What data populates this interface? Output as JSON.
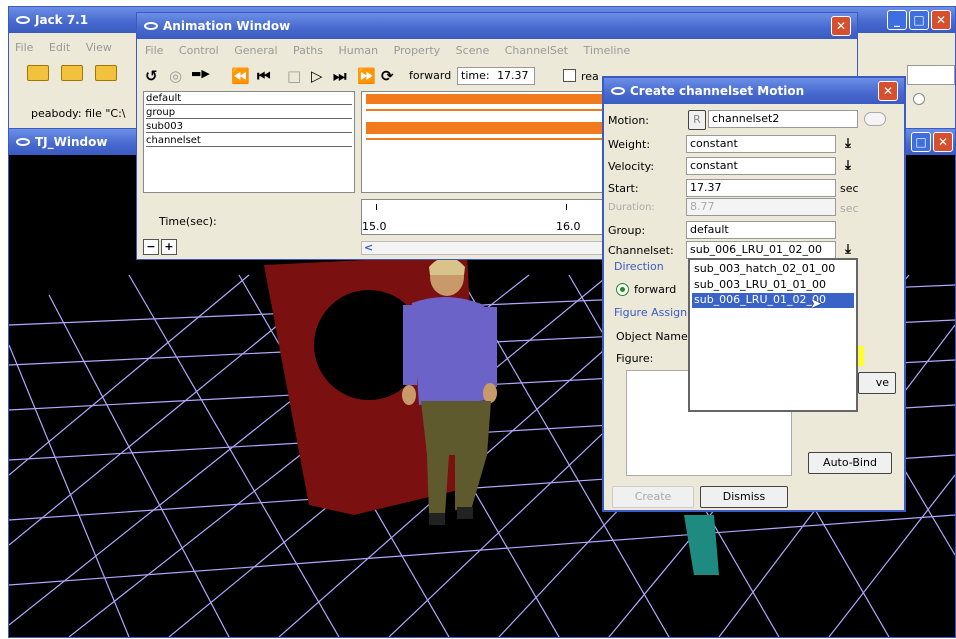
{
  "jack": {
    "title": "Jack 7.1",
    "menu": [
      "File",
      "Edit",
      "View"
    ],
    "status": "peabody: file \"C:\\"
  },
  "tj": {
    "title": "TJ_Window"
  },
  "anim": {
    "title": "Animation Window",
    "menu": [
      "File",
      "Control",
      "General",
      "Paths",
      "Human",
      "Property",
      "Scene",
      "ChannelSet",
      "Timeline"
    ],
    "direction": "forward",
    "time_label": "time:",
    "time_value": "17.37",
    "real_label": "rea",
    "tracks": [
      "default",
      "group",
      "sub003",
      "channelset"
    ],
    "time_axis_label": "Time(sec):",
    "tick_15": "15.0",
    "tick_16": "16.0",
    "minus": "−",
    "plus": "+",
    "scroll_left": "<"
  },
  "dialog": {
    "title": "Create channelset Motion",
    "motion_label": "Motion:",
    "motion_r": "R",
    "motion_value": "channelset2",
    "weight_label": "Weight:",
    "weight_value": "constant",
    "velocity_label": "Velocity:",
    "velocity_value": "constant",
    "start_label": "Start:",
    "start_value": "17.37",
    "start_unit": "sec",
    "duration_label": "Duration:",
    "duration_value": "8.77",
    "duration_unit": "sec",
    "group_label": "Group:",
    "group_value": "default",
    "channelset_label": "Channelset:",
    "channelset_value": "sub_006_LRU_01_02_00",
    "direction_label": "Direction",
    "forward_label": "forward",
    "figure_assign_label": "Figure Assign",
    "object_name_label": "Object Name",
    "figure_label": "Figure:",
    "options": [
      "sub_003_hatch_02_01_00",
      "sub_003_LRU_01_01_00",
      "sub_006_LRU_01_02_00"
    ],
    "selected_index": 2,
    "remove_label": "ve",
    "autobind_label": "Auto-Bind",
    "create_label": "Create",
    "dismiss_label": "Dismiss"
  },
  "colors": {
    "titlebar": "#4668cf",
    "close": "#d6502e",
    "track_orange": "#f07a1c",
    "selection": "#3a63c8",
    "viewport_bg": "#000000",
    "grid": "#b0a8ff"
  }
}
